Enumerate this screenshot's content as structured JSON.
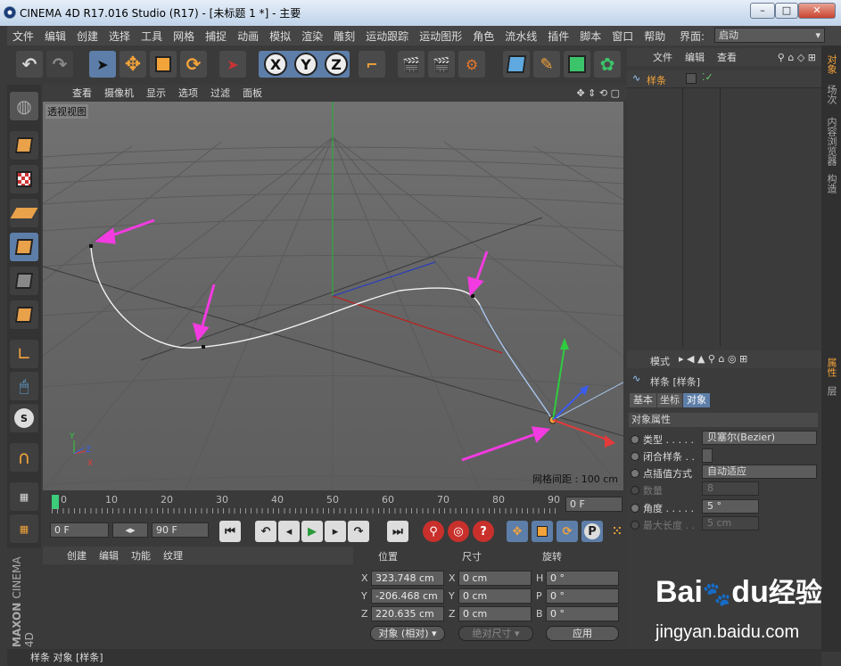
{
  "window": {
    "title": "CINEMA 4D R17.016 Studio (R17) - [未标题 1 *] - 主要",
    "buttons": [
      "–",
      "□",
      "✕"
    ]
  },
  "menubar": {
    "items": [
      "文件",
      "编辑",
      "创建",
      "选择",
      "工具",
      "网格",
      "捕捉",
      "动画",
      "模拟",
      "渲染",
      "雕刻",
      "运动跟踪",
      "运动图形",
      "角色",
      "流水线",
      "插件",
      "脚本",
      "窗口",
      "帮助"
    ],
    "layout_label": "界面:",
    "layout_value": "启动"
  },
  "toolbar": {
    "axis": [
      "X",
      "Y",
      "Z"
    ]
  },
  "viewport": {
    "menu": [
      "查看",
      "摄像机",
      "显示",
      "选项",
      "过滤",
      "面板"
    ],
    "label": "透视视图",
    "grid_spacing": "网格间距 : 100 cm"
  },
  "timeline": {
    "ticks": [
      "0",
      "10",
      "20",
      "30",
      "40",
      "50",
      "60",
      "70",
      "80",
      "90"
    ],
    "current_frame": "0 F"
  },
  "transport": {
    "start": "0 F",
    "end": "90 F"
  },
  "material": {
    "menu": [
      "创建",
      "编辑",
      "功能",
      "纹理"
    ]
  },
  "coords": {
    "headers": [
      "位置",
      "尺寸",
      "旋转"
    ],
    "rows": [
      {
        "axis": "X",
        "pos": "323.748 cm",
        "size_axis": "X",
        "size": "0 cm",
        "rot_axis": "H",
        "rot": "0 °"
      },
      {
        "axis": "Y",
        "pos": "-206.468 cm",
        "size_axis": "Y",
        "size": "0 cm",
        "rot_axis": "P",
        "rot": "0 °"
      },
      {
        "axis": "Z",
        "pos": "220.635 cm",
        "size_axis": "Z",
        "size": "0 cm",
        "rot_axis": "B",
        "rot": "0 °"
      }
    ],
    "mode": "对象 (相对)",
    "size_mode": "绝对尺寸",
    "apply": "应用"
  },
  "objects": {
    "menu": [
      "文件",
      "编辑",
      "查看"
    ],
    "item": "样条"
  },
  "right_tabs": [
    "对象",
    "场次",
    "内容浏览器",
    "构造",
    "属性",
    "层"
  ],
  "attributes": {
    "menu_label": "模式",
    "object_title": "样条 [样条]",
    "tabs": [
      "基本",
      "坐标",
      "对象"
    ],
    "section": "对象属性",
    "rows": [
      {
        "label": "类型 . . . . .",
        "value": "贝塞尔(Bezier)"
      },
      {
        "label": "闭合样条 . .",
        "value": ""
      },
      {
        "label": "点插值方式",
        "value": "自动适应"
      },
      {
        "label": "数量",
        "value": "8"
      },
      {
        "label": "角度 . . . . .",
        "value": "5 °"
      },
      {
        "label": "最大长度 . .",
        "value": "5 cm"
      }
    ]
  },
  "statusbar": {
    "text": "样条 对象 [样条]"
  },
  "logo": {
    "brand": "MAXON",
    "product": "CINEMA 4D"
  },
  "watermark": {
    "brand": "Bai",
    "brand2": "du",
    "suffix": "经验",
    "url": "jingyan.baidu.com"
  }
}
